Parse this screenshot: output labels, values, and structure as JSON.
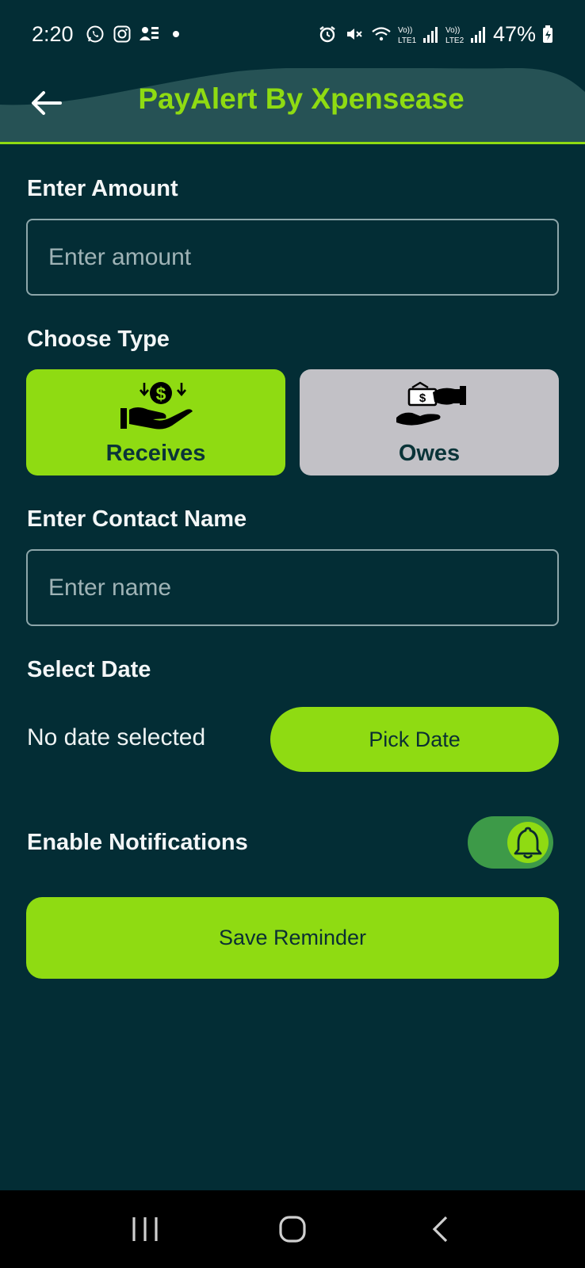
{
  "status_bar": {
    "time": "2:20",
    "left_icons": [
      "whatsapp-icon",
      "instagram-icon",
      "contacts-icon",
      "dot-icon"
    ],
    "right_icons": [
      "alarm-icon",
      "mute-icon",
      "wifi-icon",
      "signal-lte1-icon",
      "signal-lte2-icon"
    ],
    "battery": "47%"
  },
  "app_bar": {
    "title": "PayAlert By Xpensease",
    "accent": "#8fdb12"
  },
  "amount": {
    "label": "Enter Amount",
    "placeholder": "Enter amount",
    "value": ""
  },
  "type": {
    "label": "Choose Type",
    "options": [
      {
        "label": "Receives",
        "icon": "hand-receive-money-icon",
        "selected": true
      },
      {
        "label": "Owes",
        "icon": "hand-give-money-icon",
        "selected": false
      }
    ]
  },
  "contact": {
    "label": "Enter Contact Name",
    "placeholder": "Enter name",
    "value": ""
  },
  "date": {
    "label": "Select Date",
    "status": "No date selected",
    "button": "Pick Date"
  },
  "notifications": {
    "label": "Enable Notifications",
    "enabled": true,
    "icon": "bell-icon"
  },
  "save": {
    "button": "Save Reminder"
  },
  "nav_bar": {
    "buttons": [
      "recents-icon",
      "home-icon",
      "back-icon"
    ]
  }
}
